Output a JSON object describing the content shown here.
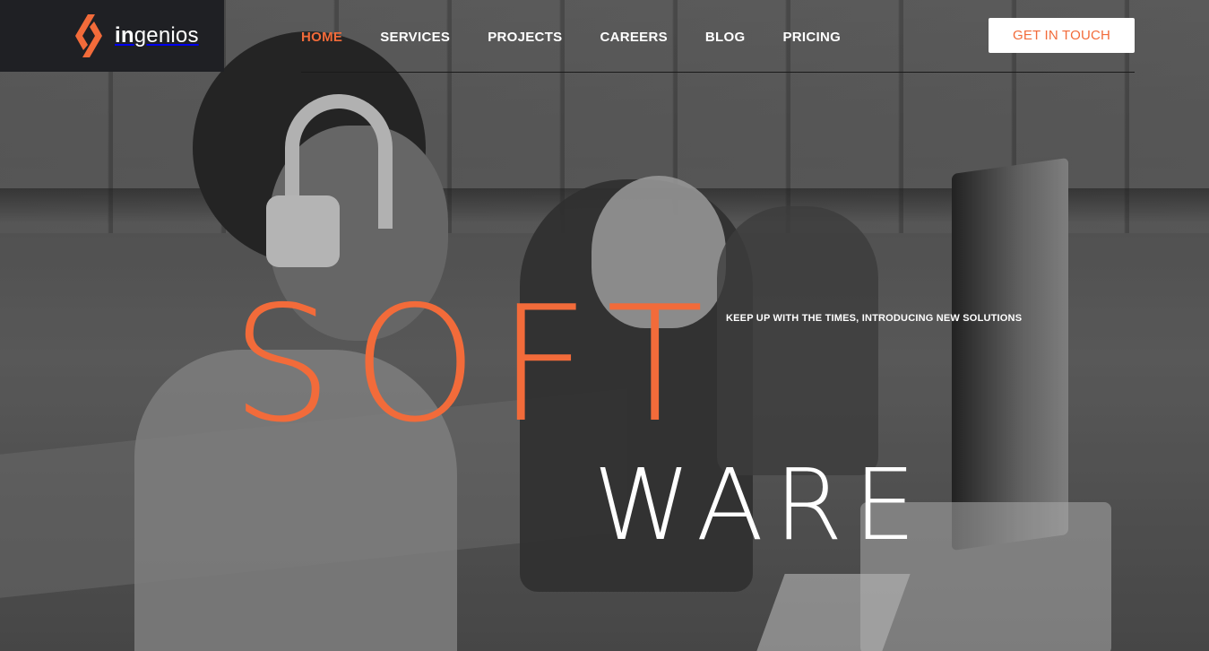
{
  "brand": {
    "name_bold": "in",
    "name_rest": "genios",
    "accent_color": "#f26b3a"
  },
  "nav": {
    "items": [
      {
        "label": "HOME",
        "active": true
      },
      {
        "label": "SERVICES",
        "active": false
      },
      {
        "label": "PROJECTS",
        "active": false
      },
      {
        "label": "CAREERS",
        "active": false
      },
      {
        "label": "BLOG",
        "active": false
      },
      {
        "label": "PRICING",
        "active": false
      }
    ]
  },
  "cta": {
    "label": "GET IN TOUCH"
  },
  "hero": {
    "word_primary": "SOFT",
    "word_secondary": "WARE",
    "tagline": "KEEP UP WITH THE TIMES, INTRODUCING NEW SOLUTIONS",
    "background_image": "grayscale photo of people working at computers with headphones"
  }
}
